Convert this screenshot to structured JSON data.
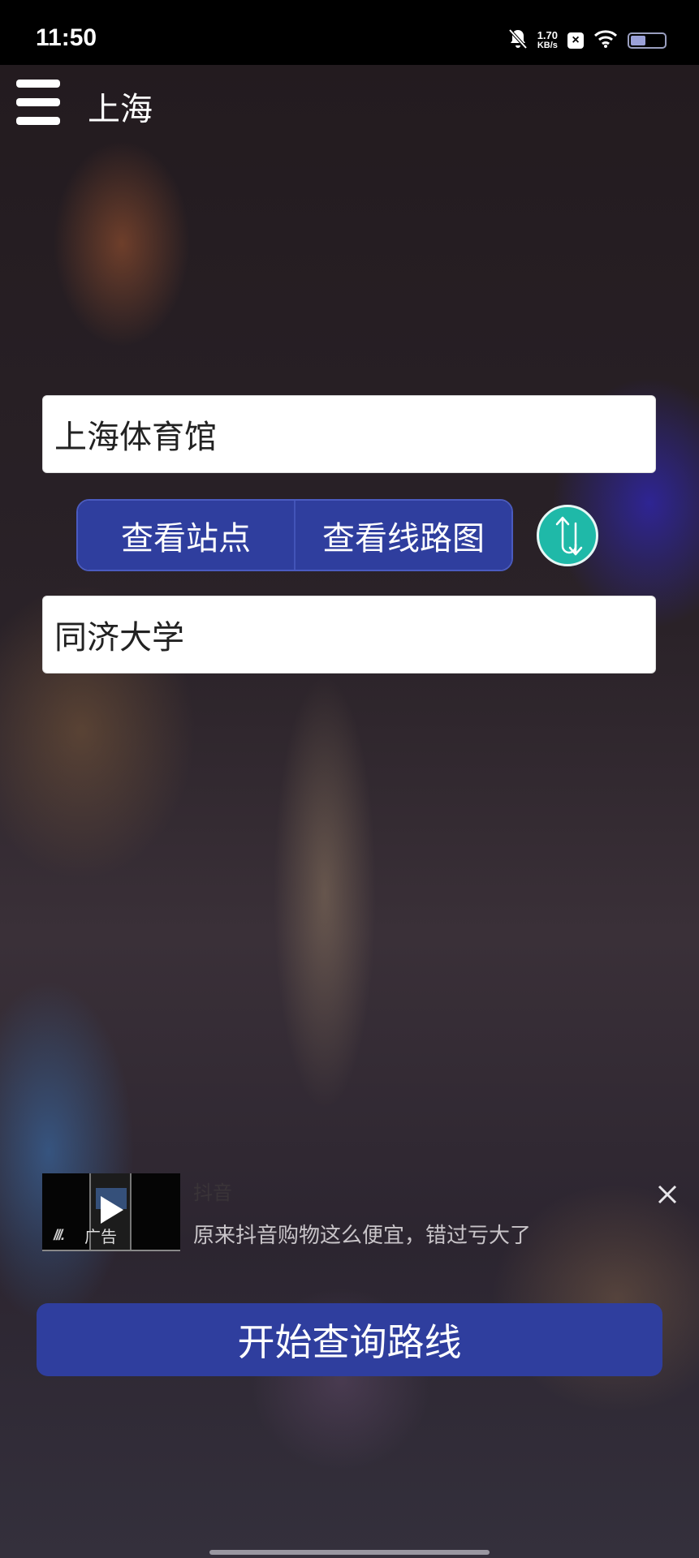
{
  "status_bar": {
    "time": "11:50",
    "net_speed_value": "1.70",
    "net_speed_unit": "KB/s",
    "x_badge": "×",
    "battery_level": 0.4,
    "icons": [
      "bell-muted-icon",
      "x-app-icon",
      "wifi-icon",
      "battery-icon"
    ]
  },
  "header": {
    "menu_icon": "hamburger-menu-icon",
    "city": "上海"
  },
  "route": {
    "from_station": "上海体育馆",
    "to_station": "同济大学",
    "view_stations_label": "查看站点",
    "view_map_label": "查看线路图",
    "swap_icon": "swap-arrows-icon"
  },
  "ad": {
    "title": "抖音",
    "description": "原来抖音购物这么便宜，错过亏大了",
    "tag": "广告",
    "logo_text": "///.",
    "close_icon": "close-icon",
    "play_icon": "play-icon"
  },
  "actions": {
    "search_label": "开始查询路线"
  },
  "colors": {
    "primary_button": "#2f3e9e",
    "swap_button": "#1fb9a8",
    "status_bar_bg": "#000000"
  }
}
